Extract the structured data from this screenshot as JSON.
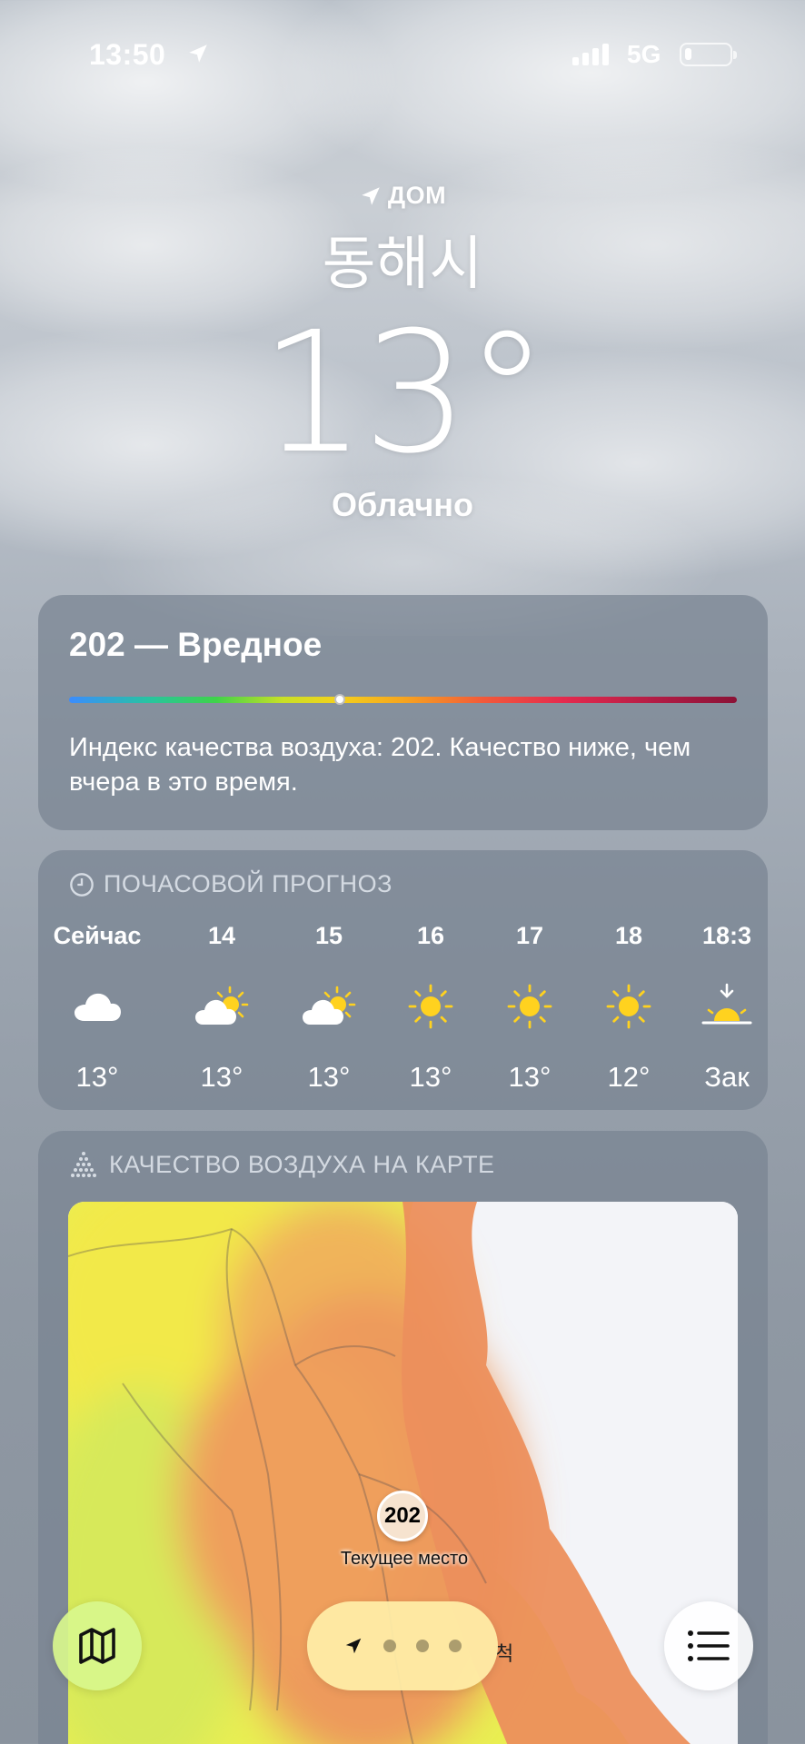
{
  "status_bar": {
    "time": "13:50",
    "network": "5G"
  },
  "header": {
    "home_label": "ДОМ",
    "city": "동해시",
    "temperature": "13°",
    "condition": "Облачно"
  },
  "aqi": {
    "title": "202 — Вредное",
    "level_fraction": 0.405,
    "description": "Индекс качества воздуха: 202. Качество ниже, чем вчера в это время."
  },
  "hourly": {
    "heading": "ПОЧАСОВОЙ ПРОГНОЗ",
    "items": [
      {
        "label": "Сейчас",
        "icon": "cloud-icon",
        "temp": "13°"
      },
      {
        "label": "14",
        "icon": "partly-sunny-icon",
        "temp": "13°"
      },
      {
        "label": "15",
        "icon": "partly-sunny-icon",
        "temp": "13°"
      },
      {
        "label": "16",
        "icon": "sun-icon",
        "temp": "13°"
      },
      {
        "label": "17",
        "icon": "sun-icon",
        "temp": "13°"
      },
      {
        "label": "18",
        "icon": "sun-icon",
        "temp": "12°"
      },
      {
        "label": "18:3",
        "icon": "sunset-icon",
        "temp": "Зак"
      }
    ]
  },
  "air_map": {
    "heading": "КАЧЕСТВО ВОЗДУХА НА КАРТЕ",
    "marker_value": "202",
    "marker_label": "Текущее место",
    "partial_place": "척"
  },
  "colors": {
    "map_button": "#d8f68c",
    "pager": "#ffeea8",
    "aqi_low": "#f3d21c",
    "aqi_high": "#e8774a"
  }
}
